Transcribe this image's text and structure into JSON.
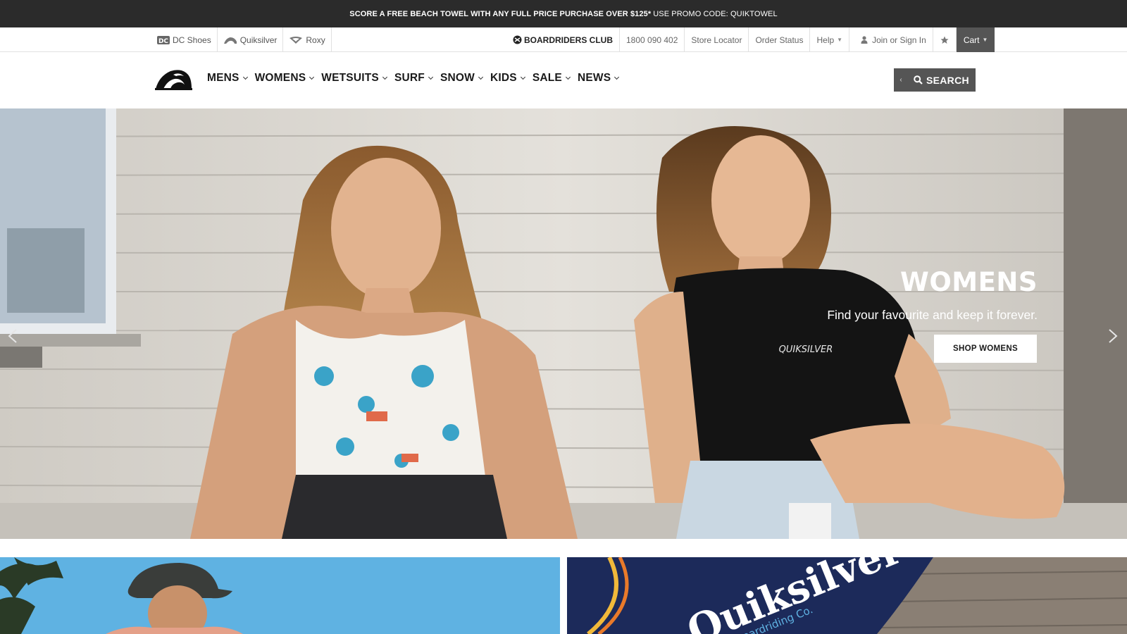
{
  "promo": {
    "bold_text": "SCORE A FREE BEACH TOWEL WITH ANY FULL PRICE PURCHASE OVER $125*",
    "code_text": "USE PROMO CODE: QUIKTOWEL"
  },
  "brands": [
    {
      "label": "DC Shoes",
      "icon": "dc-shoes-logo-icon"
    },
    {
      "label": "Quiksilver",
      "icon": "quiksilver-logo-icon"
    },
    {
      "label": "Roxy",
      "icon": "roxy-logo-icon"
    }
  ],
  "utility": {
    "club_label": "BOARDRIDERS CLUB",
    "phone": "1800 090 402",
    "store_locator": "Store Locator",
    "order_status": "Order Status",
    "help": "Help",
    "join": "Join or Sign In",
    "cart": "Cart"
  },
  "nav": {
    "items": [
      "MENS",
      "WOMENS",
      "WETSUITS",
      "SURF",
      "SNOW",
      "KIDS",
      "SALE",
      "NEWS"
    ],
    "search_label": "SEARCH"
  },
  "hero": {
    "title": "WOMENS",
    "subtitle": "Find your favourite and keep it forever.",
    "cta": "SHOP WOMENS",
    "shirt_text": "QUIKSILVER"
  },
  "tiles": {
    "towel_text": "Quiksilver",
    "towel_sub": "al Boardriding Co."
  },
  "colors": {
    "promo_bg": "#2b2b2b",
    "cart_bg": "#555555",
    "search_bg": "#555555",
    "cta_bg": "#ffffff"
  }
}
